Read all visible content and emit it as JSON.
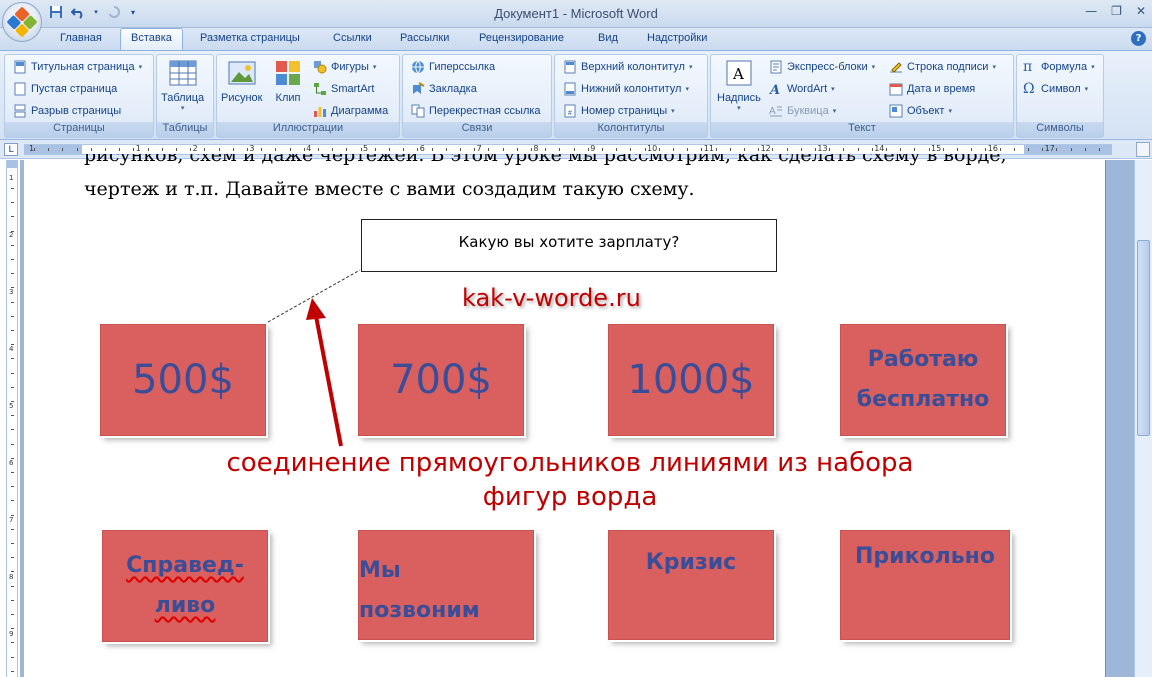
{
  "window": {
    "title": "Документ1 - Microsoft Word"
  },
  "tabs": [
    "Главная",
    "Вставка",
    "Разметка страницы",
    "Ссылки",
    "Рассылки",
    "Рецензирование",
    "Вид",
    "Надстройки"
  ],
  "active_tab": "Вставка",
  "ribbon": {
    "pages": {
      "label": "Страницы",
      "items": [
        "Титульная страница",
        "Пустая страница",
        "Разрыв страницы"
      ]
    },
    "tables": {
      "label": "Таблицы",
      "items": [
        "Таблица"
      ]
    },
    "illustrations": {
      "label": "Иллюстрации",
      "items": [
        "Рисунок",
        "Клип",
        "Фигуры",
        "SmartArt",
        "Диаграмма"
      ]
    },
    "links": {
      "label": "Связи",
      "items": [
        "Гиперссылка",
        "Закладка",
        "Перекрестная ссылка"
      ]
    },
    "headers": {
      "label": "Колонтитулы",
      "items": [
        "Верхний колонтитул",
        "Нижний колонтитул",
        "Номер страницы"
      ]
    },
    "text": {
      "label": "Текст",
      "items": [
        "Надпись",
        "Экспресс-блоки",
        "WordArt",
        "Буквица",
        "Строка подписи",
        "Дата и время",
        "Объект"
      ]
    },
    "symbols": {
      "label": "Символы",
      "items": [
        "Формула",
        "Символ"
      ]
    }
  },
  "ruler": {
    "h_numbers": [
      "1",
      "1",
      "2",
      "3",
      "4",
      "5",
      "6",
      "7",
      "8",
      "9",
      "10",
      "11",
      "12",
      "13",
      "14",
      "15",
      "16",
      "17"
    ],
    "v_numbers": [
      "1",
      "2",
      "3",
      "4",
      "5",
      "6",
      "7",
      "8",
      "9"
    ]
  },
  "document": {
    "line1": "рисунков, схем и даже чертежей. В этом уроке мы рассмотрим, как сделать схему в ворде,",
    "line2": "чертеж и т.п. Давайте вместе с вами создадим такую схему.",
    "question": "Какую вы хотите зарплату?",
    "watermark": "kak-v-worde.ru",
    "annotation_line1": "соединение прямоугольников линиями из набора",
    "annotation_line2": "фигур ворда",
    "boxes_row1": [
      "500$",
      "700$",
      "1000$",
      "Работаю бесплатно"
    ],
    "boxes_row2": [
      "Справед-",
      "ливо",
      "Мы",
      "позвоним",
      "Кризис",
      "Прикольно"
    ],
    "box4_lines": [
      "Работаю",
      "бесплатно"
    ]
  },
  "colors": {
    "box_fill": "#d9605e",
    "box_text": "#3a4d99",
    "annotation": "#c00000"
  }
}
